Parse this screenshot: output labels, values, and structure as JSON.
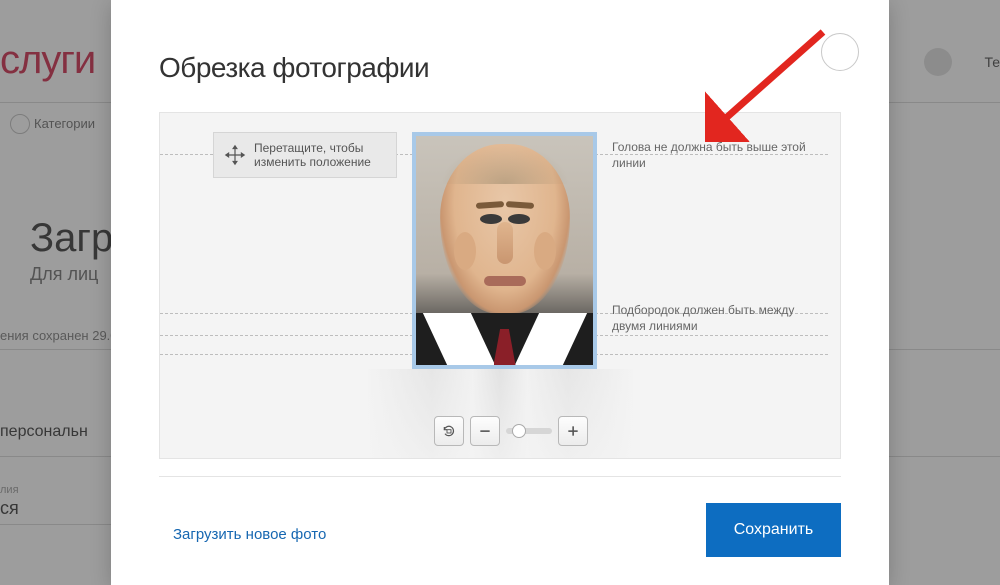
{
  "background": {
    "logo": "слуги",
    "breadcrumb": "Категории",
    "title": "Загр",
    "subtitle": "Для лиц",
    "saved_note": "ения сохранен 29.0",
    "section": "персональн",
    "field_label": "лия",
    "field_value": "ся",
    "user_short": "Те"
  },
  "modal": {
    "title": "Обрезка фотографии",
    "drag_hint": "Перетащите, чтобы изменить положение",
    "guide_top": "Голова не должна быть выше этой линии",
    "guide_chin": "Подбородок должен быть между двумя линиями",
    "upload_new": "Загрузить новое фото",
    "save": "Сохранить"
  }
}
